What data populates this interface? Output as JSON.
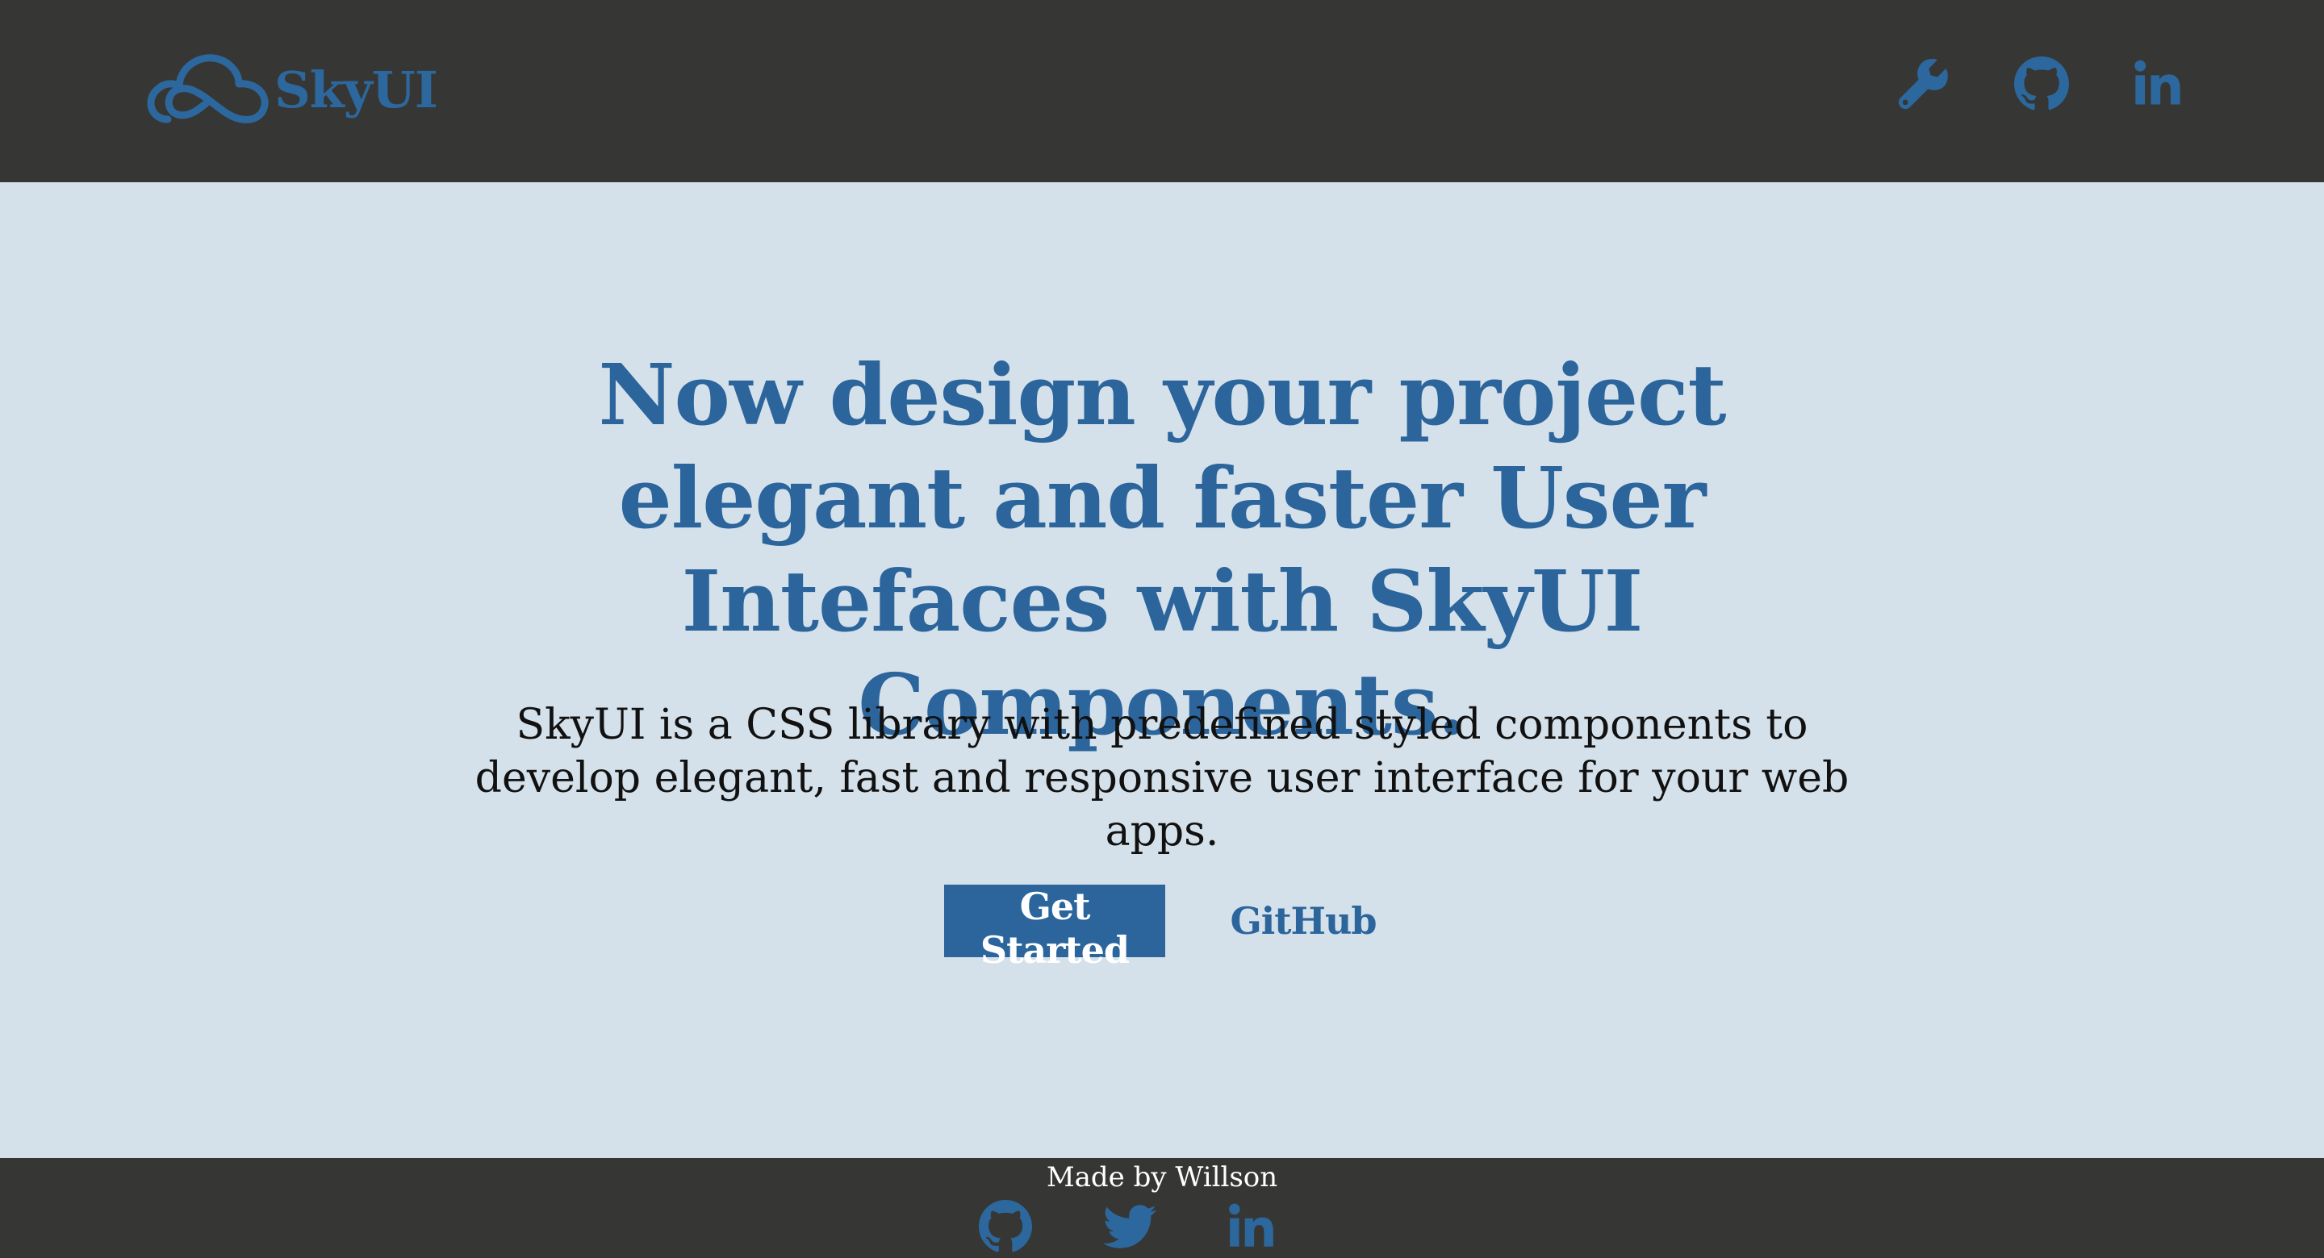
{
  "header": {
    "brand": "SkyUI",
    "icons": [
      "cloud-logo-icon",
      "wrench-icon",
      "github-icon",
      "linkedin-icon"
    ]
  },
  "hero": {
    "title": "Now design your project elegant and faster User Intefaces with SkyUI Components.",
    "subtitle": "SkyUI is a CSS library with predefined styled components to develop elegant, fast and responsive user interface for your web apps.",
    "primary_button": "Get Started",
    "secondary_link": "GitHub"
  },
  "footer": {
    "credit": "Made by Willson",
    "icons": [
      "github-icon",
      "twitter-icon",
      "linkedin-icon"
    ]
  },
  "colors": {
    "accent": "#2b659c",
    "dark_bar": "#363734",
    "background": "#d5e1ea"
  }
}
